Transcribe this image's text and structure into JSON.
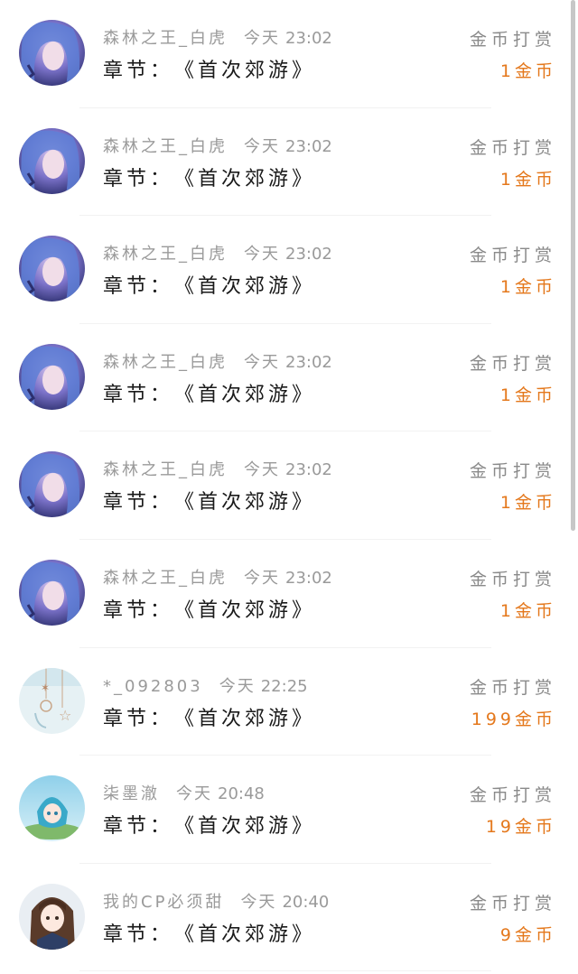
{
  "list": {
    "items": [
      {
        "user": "森林之王_白虎",
        "time": "今天",
        "clock": "23:02",
        "chapter_label": "章节：",
        "chapter": "《首次郊游》",
        "type": "金币打赏",
        "amount": "1金币",
        "avatar": "blue-hair-portrait"
      },
      {
        "user": "森林之王_白虎",
        "time": "今天",
        "clock": "23:02",
        "chapter_label": "章节：",
        "chapter": "《首次郊游》",
        "type": "金币打赏",
        "amount": "1金币",
        "avatar": "blue-hair-portrait"
      },
      {
        "user": "森林之王_白虎",
        "time": "今天",
        "clock": "23:02",
        "chapter_label": "章节：",
        "chapter": "《首次郊游》",
        "type": "金币打赏",
        "amount": "1金币",
        "avatar": "blue-hair-portrait"
      },
      {
        "user": "森林之王_白虎",
        "time": "今天",
        "clock": "23:02",
        "chapter_label": "章节：",
        "chapter": "《首次郊游》",
        "type": "金币打赏",
        "amount": "1金币",
        "avatar": "blue-hair-portrait"
      },
      {
        "user": "森林之王_白虎",
        "time": "今天",
        "clock": "23:02",
        "chapter_label": "章节：",
        "chapter": "《首次郊游》",
        "type": "金币打赏",
        "amount": "1金币",
        "avatar": "blue-hair-portrait"
      },
      {
        "user": "森林之王_白虎",
        "time": "今天",
        "clock": "23:02",
        "chapter_label": "章节：",
        "chapter": "《首次郊游》",
        "type": "金币打赏",
        "amount": "1金币",
        "avatar": "blue-hair-portrait"
      },
      {
        "user": "*_092803",
        "time": "今天",
        "clock": "22:25",
        "chapter_label": "章节：",
        "chapter": "《首次郊游》",
        "type": "金币打赏",
        "amount": "199金币",
        "avatar": "star-mobile"
      },
      {
        "user": "柒墨澈",
        "time": "今天",
        "clock": "20:48",
        "chapter_label": "章节：",
        "chapter": "《首次郊游》",
        "type": "金币打赏",
        "amount": "19金币",
        "avatar": "anime-girl-blue"
      },
      {
        "user": "我的CP必须甜",
        "time": "今天",
        "clock": "20:40",
        "chapter_label": "章节：",
        "chapter": "《首次郊游》",
        "type": "金币打赏",
        "amount": "9金币",
        "avatar": "anime-girl-brown"
      }
    ]
  },
  "colors": {
    "amount": "#e4781c",
    "meta": "#9a9a9a",
    "chapter": "#1a1a1a"
  }
}
